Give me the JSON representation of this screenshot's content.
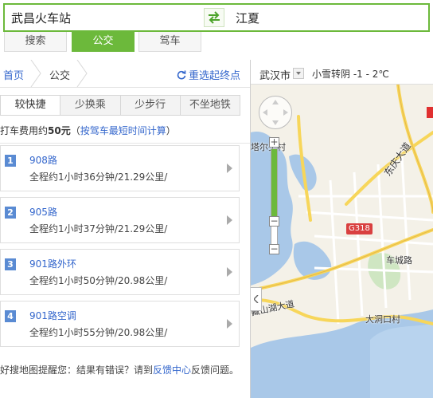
{
  "search": {
    "from_value": "武昌火车站",
    "to_value": "江夏"
  },
  "mode_tabs": [
    {
      "label": "搜索",
      "active": false
    },
    {
      "label": "公交",
      "active": true
    },
    {
      "label": "驾车",
      "active": false
    }
  ],
  "breadcrumb": {
    "home": "首页",
    "current": "公交",
    "reselect": "重选起终点"
  },
  "strategies": [
    "较快捷",
    "少换乘",
    "少步行",
    "不坐地铁"
  ],
  "taxi": {
    "prefix": "打车费用约",
    "fare": "50元",
    "paren_open": "（",
    "link": "按驾车最短时间计算",
    "paren_close": "）"
  },
  "routes": [
    {
      "num": "1",
      "name": "908路",
      "detail": "全程约1小时36分钟/21.29公里/"
    },
    {
      "num": "2",
      "name": "905路",
      "detail": "全程约1小时37分钟/21.29公里/"
    },
    {
      "num": "3",
      "name": "901路外环",
      "detail": "全程约1小时50分钟/20.98公里/"
    },
    {
      "num": "4",
      "name": "901路空调",
      "detail": "全程约1小时55分钟/20.98公里/"
    }
  ],
  "footer": {
    "text1": "好搜地图提醒您：结果有错误？请到",
    "link": "反馈中心",
    "text2": "反馈问题。"
  },
  "map_header": {
    "city": "武汉市",
    "weather": "小雪转阴 -1 - 2℃"
  },
  "map": {
    "labels": {
      "tarl_village": "塔尔头村",
      "dongting_avenue": "东庆大道",
      "g318": "G318",
      "chechengl_road": "车城路",
      "tanshanhu_avenue": "藏山湖大道",
      "dadongkou_village": "大洞口村"
    },
    "zoom_level": 0.7
  },
  "colors": {
    "accent_green": "#6cb93b",
    "link_blue": "#3366cc",
    "route_badge": "#5a8bd3",
    "water": "#a9c8e8",
    "road_yellow": "#f7d65a"
  }
}
